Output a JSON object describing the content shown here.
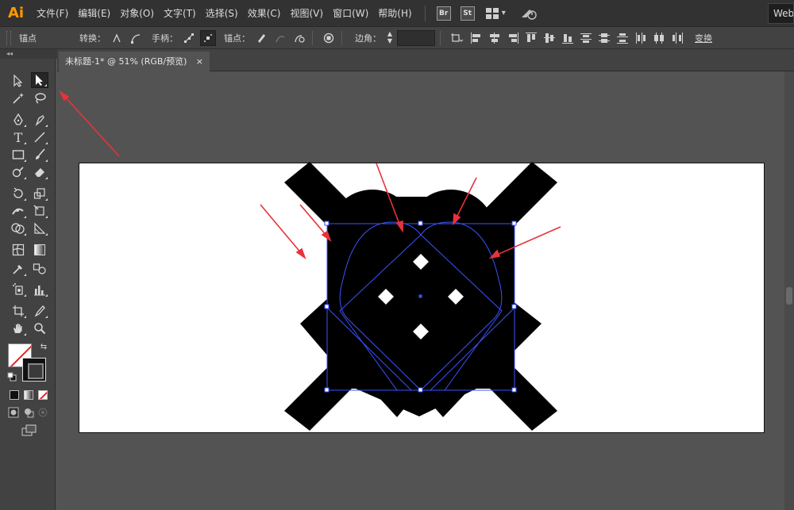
{
  "app": {
    "logo": "Ai",
    "workspace": "Web"
  },
  "menu": {
    "items": [
      "文件(F)",
      "编辑(E)",
      "对象(O)",
      "文字(T)",
      "选择(S)",
      "效果(C)",
      "视图(V)",
      "窗口(W)",
      "帮助(H)"
    ],
    "bridge": "Br",
    "stock": "St"
  },
  "control_bar": {
    "anchor_label": "锚点",
    "convert_label": "转换：",
    "handles_label": "手柄：",
    "anchors_label": "锚点：",
    "corner_label": "边角：",
    "transform_label": "变换"
  },
  "document": {
    "tab_title": "未标题-1* @ 51% (RGB/预览)",
    "close_glyph": "×"
  },
  "tools": {
    "names": [
      "direct-selection-tool",
      "selection-tool",
      "magic-wand-tool",
      "lasso-tool",
      "pen-tool",
      "curvature-tool",
      "type-tool",
      "line-tool",
      "rectangle-tool",
      "paintbrush-tool",
      "shaper-tool",
      "eraser-tool",
      "rotate-tool",
      "scale-tool",
      "width-tool",
      "free-transform-tool",
      "shape-builder-tool",
      "perspective-grid-tool",
      "mesh-tool",
      "gradient-tool",
      "eyedropper-tool",
      "blend-tool",
      "symbol-sprayer-tool",
      "column-graph-tool",
      "artboard-tool",
      "slice-tool",
      "hand-tool",
      "zoom-tool"
    ],
    "selected": "selection-tool"
  },
  "colors": {
    "accent_orange": "#ff9a00",
    "annotation_red": "#e8323a",
    "selection_blue": "#3a53ff",
    "fill_none_red": "#e0262a"
  }
}
